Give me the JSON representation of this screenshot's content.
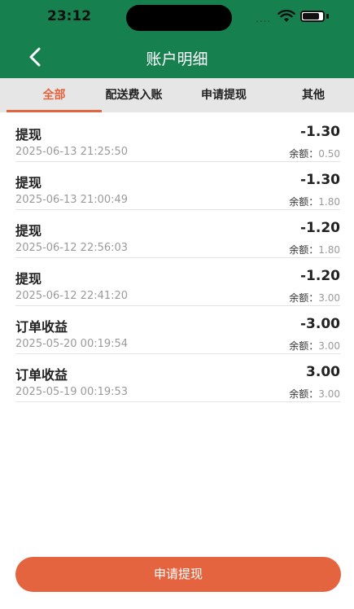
{
  "status_bar": {
    "time": "23:12",
    "signal": "...."
  },
  "header": {
    "title": "账户明细",
    "bg_color": "#17804f"
  },
  "tabs": [
    {
      "label": "全部",
      "active": true
    },
    {
      "label": "配送费入账",
      "active": false
    },
    {
      "label": "申请提现",
      "active": false
    },
    {
      "label": "其他",
      "active": false
    }
  ],
  "balance_label": "余额：",
  "records": [
    {
      "name": "提现",
      "amount": "-1.30",
      "date": "2025-06-13 21:25:50",
      "balance": "0.50"
    },
    {
      "name": "提现",
      "amount": "-1.30",
      "date": "2025-06-13 21:00:49",
      "balance": "1.80"
    },
    {
      "name": "提现",
      "amount": "-1.20",
      "date": "2025-06-12 22:56:03",
      "balance": "1.80"
    },
    {
      "name": "提现",
      "amount": "-1.20",
      "date": "2025-06-12 22:41:20",
      "balance": "3.00"
    },
    {
      "name": "订单收益",
      "amount": "-3.00",
      "date": "2025-05-20 00:19:54",
      "balance": "3.00"
    },
    {
      "name": "订单收益",
      "amount": "3.00",
      "date": "2025-05-19 00:19:53",
      "balance": "3.00"
    }
  ],
  "footer": {
    "button_label": "申请提现",
    "accent_color": "#e4643f"
  }
}
